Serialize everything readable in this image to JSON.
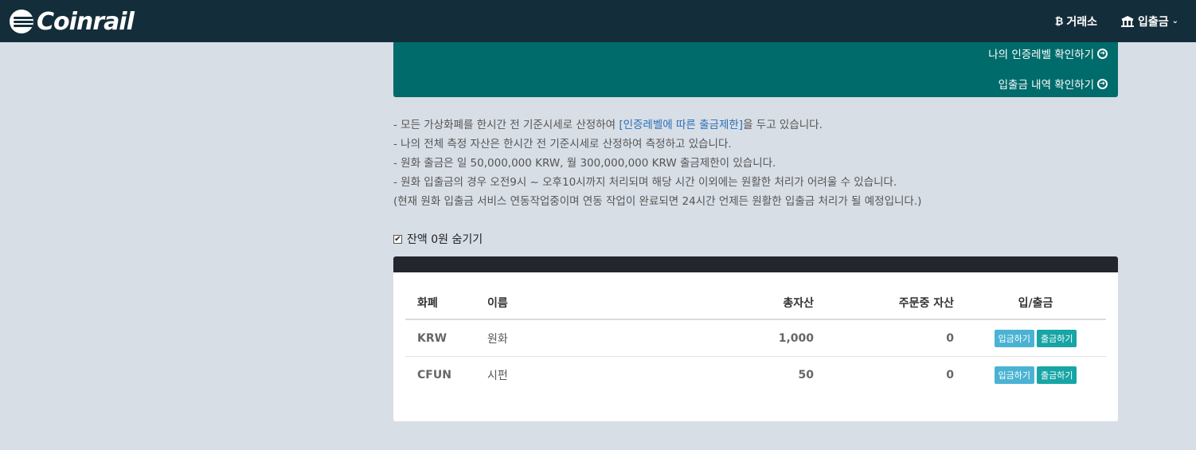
{
  "navbar": {
    "logo_text": "Coinrail",
    "exchange_label": "거래소",
    "deposit_label": "입출금"
  },
  "panel": {
    "link1": "나의 인증레벨 확인하기",
    "link2": "입출금 내역 확인하기"
  },
  "notes": {
    "line1_pre": "- 모든 가상화폐를 한시간 전 기준시세로 산정하여 ",
    "line1_link": "[인증레벨에 따른 출금제한]",
    "line1_post": "을 두고 있습니다.",
    "line2": "- 나의 전체 측정 자산은 한시간 전 기준시세로 산정하여 측정하고 있습니다.",
    "line3": "- 원화 출금은 일 50,000,000 KRW, 월 300,000,000 KRW 출금제한이 있습니다.",
    "line4": "- 원화 입출금의 경우 오전9시 ~ 오후10시까지 처리되며 해당 시간 이외에는 원활한 처리가 어려울 수 있습니다.",
    "line5": "(현재 원화 입출금 서비스 연동작업중이며 연동 작업이 완료되면 24시간 언제든 원활한 입출금 처리가 될 예정입니다.)"
  },
  "hide_zero": {
    "label": "잔액 0원 숨기기",
    "checked": true
  },
  "table": {
    "headers": [
      "화폐",
      "이름",
      "총자산",
      "주문중 자산",
      "입/출금"
    ],
    "rows": [
      {
        "currency": "KRW",
        "name": "원화",
        "total": "1,000",
        "in_order": "0",
        "deposit": "입금하기",
        "withdraw": "출금하기"
      },
      {
        "currency": "CFUN",
        "name": "시펀",
        "total": "50",
        "in_order": "0",
        "deposit": "입금하기",
        "withdraw": "출금하기"
      }
    ]
  }
}
